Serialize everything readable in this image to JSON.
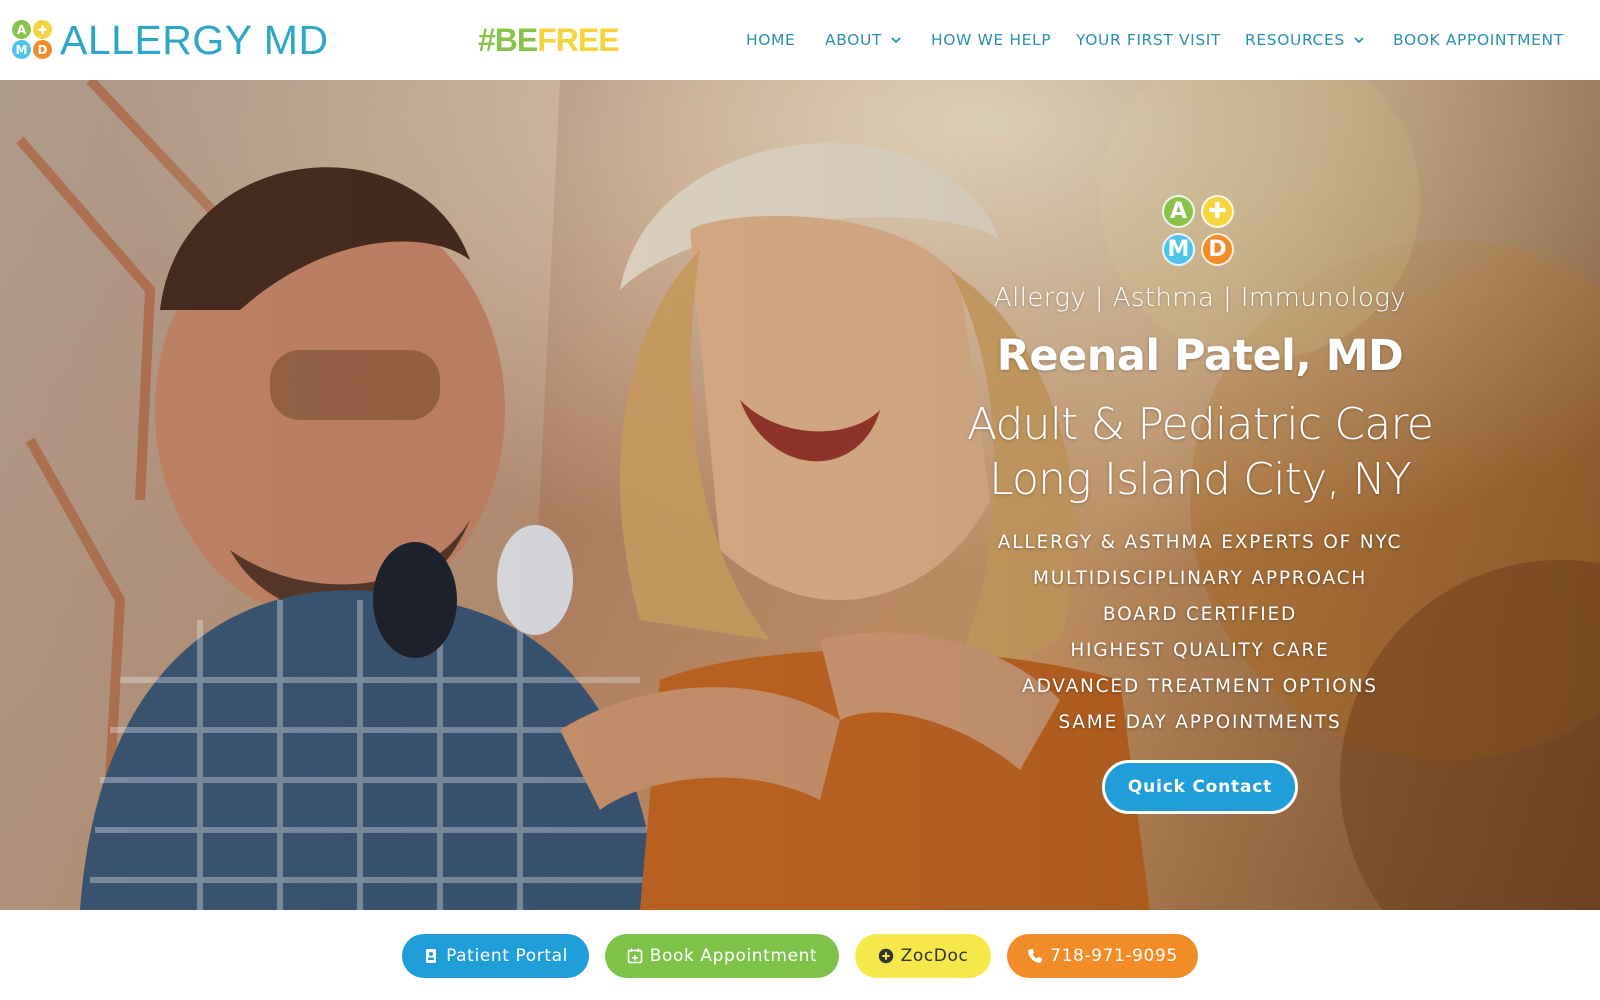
{
  "brand": {
    "logo_letters": [
      "A",
      "✚",
      "M",
      "D"
    ],
    "name": "ALLERGY MD",
    "hashtag_part1": "#BE",
    "hashtag_part2": "FREE",
    "colors": {
      "green": "#8bc34a",
      "yellow": "#f5d53f",
      "blue": "#4fc3e8",
      "orange": "#f28c28",
      "nav_text": "#2a8fb0",
      "logo_text": "#2aa7c9"
    }
  },
  "nav": {
    "items": [
      {
        "label": "HOME",
        "has_dropdown": false
      },
      {
        "label": "ABOUT",
        "has_dropdown": true
      },
      {
        "label": "HOW WE HELP",
        "has_dropdown": false
      },
      {
        "label": "YOUR FIRST VISIT",
        "has_dropdown": false
      },
      {
        "label": "RESOURCES",
        "has_dropdown": true
      },
      {
        "label": "BOOK APPOINTMENT",
        "has_dropdown": false
      }
    ]
  },
  "hero": {
    "specialty": "Allergy | Asthma | Immunology",
    "doctor": "Reenal Patel, MD",
    "care_line1": "Adult & Pediatric Care",
    "care_line2": "Long Island City, NY",
    "features": [
      "ALLERGY & ASTHMA EXPERTS OF NYC",
      "MULTIDISCIPLINARY APPROACH",
      "BOARD CERTIFIED",
      "HIGHEST QUALITY CARE",
      "ADVANCED TREATMENT OPTIONS",
      "SAME DAY APPOINTMENTS"
    ],
    "cta_label": "Quick Contact",
    "cta_color": "#1f9ed9"
  },
  "action_bar": {
    "buttons": [
      {
        "label": "Patient Portal",
        "icon": "portal-icon",
        "color": "#1f9ed9",
        "text_color": "#ffffff"
      },
      {
        "label": "Book Appointment",
        "icon": "calendar-plus-icon",
        "color": "#7fc24a",
        "text_color": "#ffffff"
      },
      {
        "label": "ZocDoc",
        "icon": "plus-circle-icon",
        "color": "#f6e84a",
        "text_color": "#333333"
      },
      {
        "label": "718-971-9095",
        "icon": "phone-icon",
        "color": "#f28c28",
        "text_color": "#ffffff"
      }
    ]
  }
}
